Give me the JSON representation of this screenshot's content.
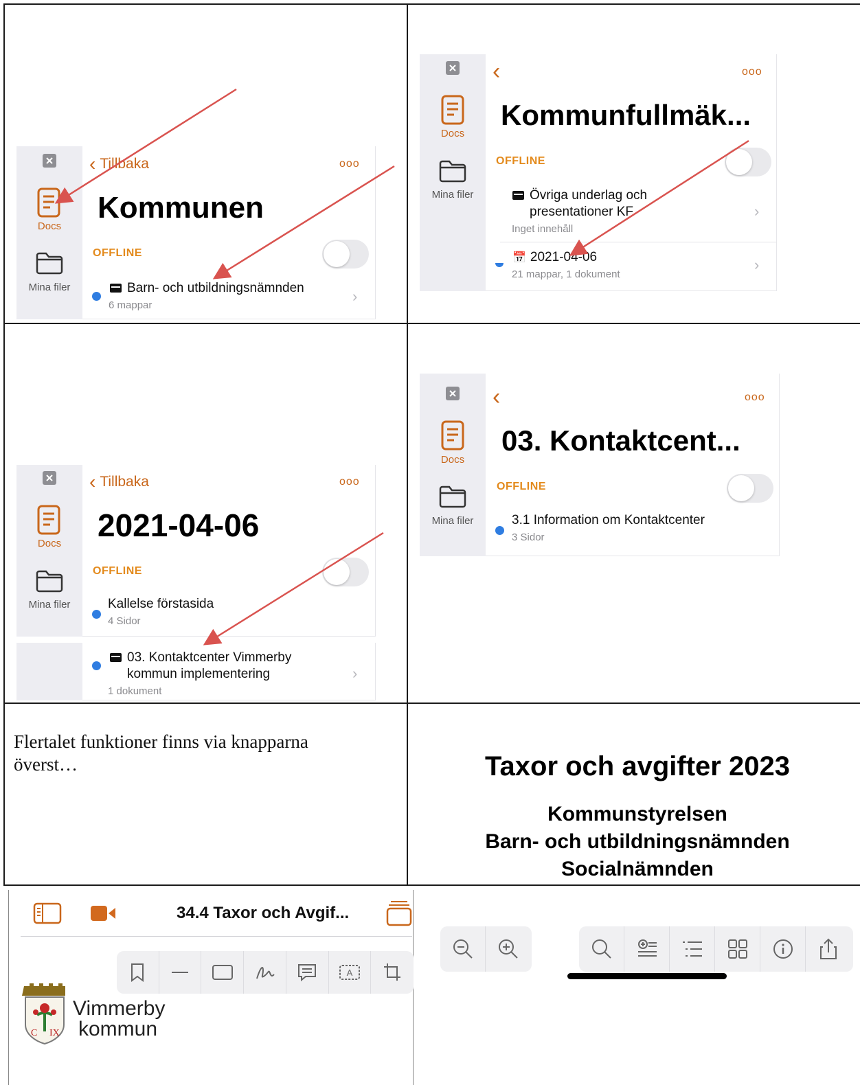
{
  "nav": {
    "back_label": "Tillbaka",
    "more": "ooo",
    "docs_label": "Docs",
    "files_label": "Mina filer",
    "offline_label": "OFFLINE"
  },
  "panel1": {
    "title": "Kommunen",
    "rows": [
      {
        "title": "Barn- och utbildningsnämnden",
        "sub": "6 mappar"
      }
    ]
  },
  "panel2": {
    "title": "Kommunfullmäk...",
    "rows": [
      {
        "title_line1": "Övriga underlag och",
        "title_line2": "presentationer KF",
        "sub": "Inget innehåll"
      },
      {
        "title": "2021-04-06",
        "sub": "21 mappar, 1 dokument"
      }
    ]
  },
  "panel3": {
    "title": "2021-04-06",
    "rows": [
      {
        "title": "Kallelse förstasida",
        "sub": "4 Sidor"
      },
      {
        "title_line1": "03. Kontaktcenter Vimmerby",
        "title_line2": "kommun implementering",
        "sub": "1 dokument"
      }
    ]
  },
  "panel4": {
    "title": "03. Kontaktcent...",
    "rows": [
      {
        "title": "3.1 Information om Kontaktcenter",
        "sub": "3 Sidor"
      }
    ]
  },
  "note": {
    "line1": "Flertalet funktioner finns via knapparna",
    "line2": "överst…"
  },
  "slide": {
    "title": "Taxor och avgifter 2023",
    "line1": "Kommunstyrelsen",
    "line2": "Barn- och utbildningsnämnden",
    "line3": "Socialnämnden"
  },
  "viewer": {
    "doc_title": "34.4 Taxor och Avgif...",
    "logo_line1": "Vimmerby",
    "logo_line2": "kommun"
  },
  "colors": {
    "accent": "#c9671b",
    "offline": "#e38a1c",
    "dot": "#2f7de1",
    "arrow": "#d9534f"
  }
}
